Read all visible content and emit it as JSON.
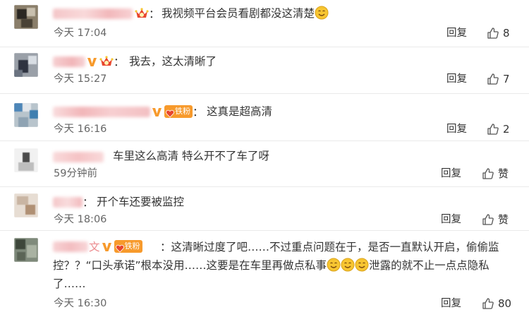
{
  "comments": [
    {
      "text": "我视频平台会员看剧都没这清楚",
      "emoji_after": "smile-emoji",
      "time": "今天 17:04",
      "reply_label": "回复",
      "like_count": "8",
      "has_crown": true
    },
    {
      "text": "我去，这太清晰了",
      "time": "今天 15:27",
      "reply_label": "回复",
      "like_count": "7",
      "has_crown": true,
      "has_vip": true
    },
    {
      "text": "这真是超高清",
      "time": "今天 16:16",
      "reply_label": "回复",
      "like_count": "2",
      "has_vip": true,
      "fan_badge": "铁粉"
    },
    {
      "text": "车里这么高清 特么开不了车了呀",
      "time": "59分钟前",
      "reply_label": "回复",
      "like_label": "赞"
    },
    {
      "text": "开个车还要被监控",
      "time": "今天 18:06",
      "reply_label": "回复",
      "like_label": "赞"
    },
    {
      "text_part1": "这清晰过度了吧……不过重点问题在于，是否一直默认开启，偷偷监控？？“口头承诺”根本没用……这要是在车里再做点私事",
      "text_part2": "泄露的就不止一点点隐私了……",
      "time": "今天 16:30",
      "reply_label": "回复",
      "like_count": "80",
      "has_vip": true,
      "fan_badge": "铁粉",
      "name_visible_char": "文"
    }
  ],
  "colon": "：",
  "colors": {
    "text": "#333333",
    "meta": "#666666",
    "divider": "#eaeaea",
    "vip_orange": "#f79a2c",
    "crown_red": "#e8462d",
    "emoji_yellow": "#f7c531"
  }
}
